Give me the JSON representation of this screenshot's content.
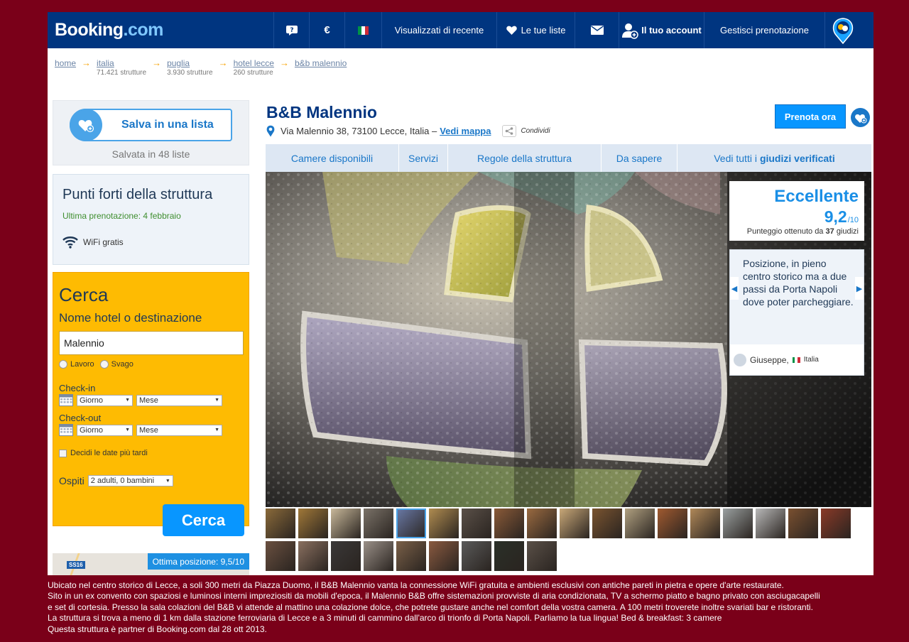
{
  "header": {
    "logo_main": "Booking",
    "logo_dotcom": ".com",
    "currency": "€",
    "recent": "Visualizzati di recente",
    "lists": "Le tue liste",
    "account": "Il tuo account",
    "manage": "Gestisci prenotazione"
  },
  "breadcrumb": [
    {
      "label": "home",
      "count": ""
    },
    {
      "label": "italia",
      "count": "71.421 strutture"
    },
    {
      "label": "puglia",
      "count": "3.930 strutture"
    },
    {
      "label": "hotel lecce",
      "count": "260 strutture"
    },
    {
      "label": "b&b malennio",
      "count": ""
    }
  ],
  "sidebar": {
    "save_label": "Salva in una lista",
    "saved_count": "Salvata in 48 liste",
    "highlights_title": "Punti forti della struttura",
    "last_booking": "Ultima prenotazione: 4 febbraio",
    "wifi": "WiFi gratis"
  },
  "search": {
    "title": "Cerca",
    "subtitle": "Nome hotel o destinazione",
    "destination_value": "Malennio",
    "destination_placeholder": "",
    "radio_work": "Lavoro",
    "radio_leisure": "Svago",
    "checkin_label": "Check-in",
    "checkout_label": "Check-out",
    "day_select": "Giorno",
    "month_select": "Mese",
    "decide_later": "Decidi le date più tardi",
    "guests_label": "Ospiti",
    "guests_value": "2 adulti, 0 bambini",
    "button": "Cerca"
  },
  "map": {
    "road": "SS16",
    "score": "Ottima posizione: 9,5/10"
  },
  "hotel": {
    "name": "B&B Malennio",
    "address": "Via Malennio 38, 73100 Lecce, Italia –",
    "map_link": "Vedi mappa",
    "share": "Condividi",
    "book_button": "Prenota ora"
  },
  "tabs": {
    "rooms": "Camere disponibili",
    "services": "Servizi",
    "rules": "Regole della struttura",
    "know": "Da sapere",
    "reviews_prefix": "Vedi tutti i",
    "reviews_bold": "giudizi verificati"
  },
  "score": {
    "word": "Eccellente",
    "value": "9,2",
    "max": "/10",
    "count_prefix": "Punteggio ottenuto da",
    "count_num": "37",
    "count_suffix": "giudizi"
  },
  "review": {
    "text": "Posizione, in pieno centro storico ma a due passi da Porta Napoli dove poter parcheggiare.",
    "name": "Giuseppe,",
    "country": "Italia"
  },
  "description": [
    "Ubicato nel centro storico di Lecce, a soli 300 metri da Piazza Duomo, il B&B Malennio vanta la connessione WiFi gratuita e ambienti esclusivi con antiche pareti in pietra e opere d'arte restaurate.",
    "Sito in un ex convento con spaziosi e luminosi interni impreziositi da mobili d'epoca, il Malennio B&B offre sistemazioni provviste di aria condizionata, TV a schermo piatto e bagno privato con asciugacapelli",
    "e set di cortesia. Presso la sala colazioni del B&B vi attende al mattino una colazione dolce, che potrete gustare anche nel comfort della vostra camera. A 100 metri troverete inoltre svariati bar e ristoranti.",
    "La struttura si trova a meno di 1 km dalla stazione ferroviaria di Lecce e a 3 minuti di cammino dall'arco di trionfo di Porta Napoli. Parliamo la tua lingua! Bed & breakfast: 3 camere",
    "Questa struttura è partner di Booking.com dal 28 ott 2013."
  ],
  "colors": {
    "header": "#003580",
    "accent": "#0896ff",
    "search_bg": "#febb02",
    "page_bg": "#7a0019"
  },
  "thumbnails": {
    "row1": [
      "#8a6a3a",
      "#a07838",
      "#c8b89a",
      "#7a7268",
      "#6a7aa8",
      "#b08c50",
      "#5a5048",
      "#8a5a38",
      "#9a6a40",
      "#c9a878",
      "#7a5430",
      "#b0a080",
      "#a05a30",
      "#b08858",
      "#9aa0a0",
      "#b8b8b8",
      "#7a5030",
      "#8a3a28"
    ],
    "row2": [
      "#6a5040",
      "#8a7060",
      "#3a3838",
      "#9a9088",
      "#7a6048",
      "#8a5a40",
      "#5a5a5a",
      "#2a3028",
      "#5a5048"
    ],
    "selected_index": 4
  }
}
